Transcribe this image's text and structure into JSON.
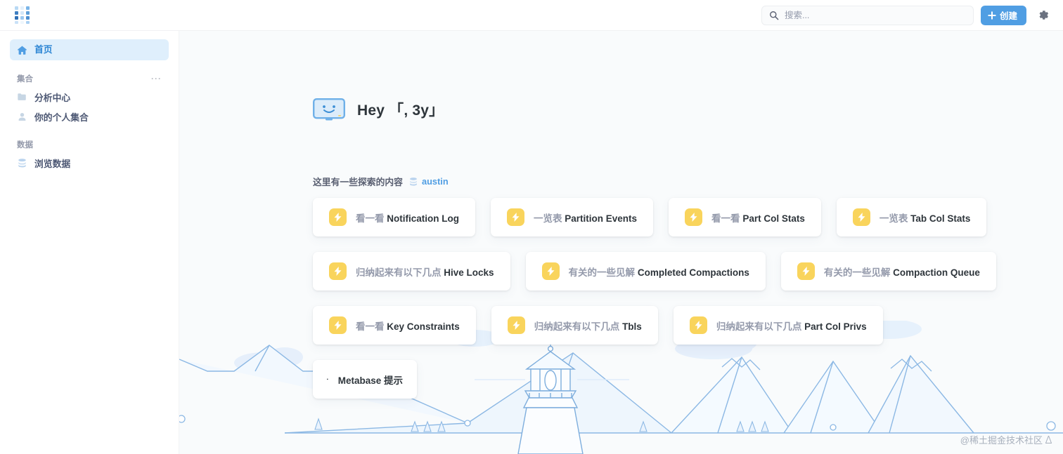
{
  "app": {
    "logo_name": "metabase-logo",
    "accent_color": "#509ee3",
    "chip_color": "#f9d45c",
    "canvas_bg": "#f9fbfc"
  },
  "topbar": {
    "search": {
      "placeholder": "搜索...",
      "value": ""
    },
    "create_button": "创建",
    "settings_label": "设置"
  },
  "sidebar": {
    "home": {
      "label": "首页"
    },
    "collections": {
      "section_label": "集合",
      "menu_glyph": "···",
      "items": [
        {
          "label": "分析中心",
          "icon": "folder-icon"
        },
        {
          "label": "你的个人集合",
          "icon": "person-icon"
        }
      ]
    },
    "data": {
      "section_label": "数据",
      "items": [
        {
          "label": "浏览数据",
          "icon": "database-icon"
        }
      ]
    }
  },
  "main": {
    "greeting": "Hey 「, 3y」",
    "explore_prefix": "这里有一些探索的内容",
    "explore_db": "austin",
    "card_rows": [
      [
        {
          "verb": "看一看",
          "entity": "Notification Log"
        },
        {
          "verb": "一览表",
          "entity": "Partition Events"
        },
        {
          "verb": "看一看",
          "entity": "Part Col Stats"
        },
        {
          "verb": "一览表",
          "entity": "Tab Col Stats"
        }
      ],
      [
        {
          "verb": "归纳起来有以下几点",
          "entity": "Hive Locks"
        },
        {
          "verb": "有关的一些见解",
          "entity": "Completed Compactions"
        },
        {
          "verb": "有关的一些见解",
          "entity": "Compaction Queue"
        }
      ],
      [
        {
          "verb": "看一看",
          "entity": "Key Constraints"
        },
        {
          "verb": "归纳起来有以下几点",
          "entity": "Tbls"
        },
        {
          "verb": "归纳起来有以下几点",
          "entity": "Part Col Privs"
        }
      ]
    ],
    "tips_card": {
      "label": "Metabase 提示",
      "icon": "book-icon"
    }
  },
  "watermark": {
    "text": "@稀土掘金技术社区"
  }
}
